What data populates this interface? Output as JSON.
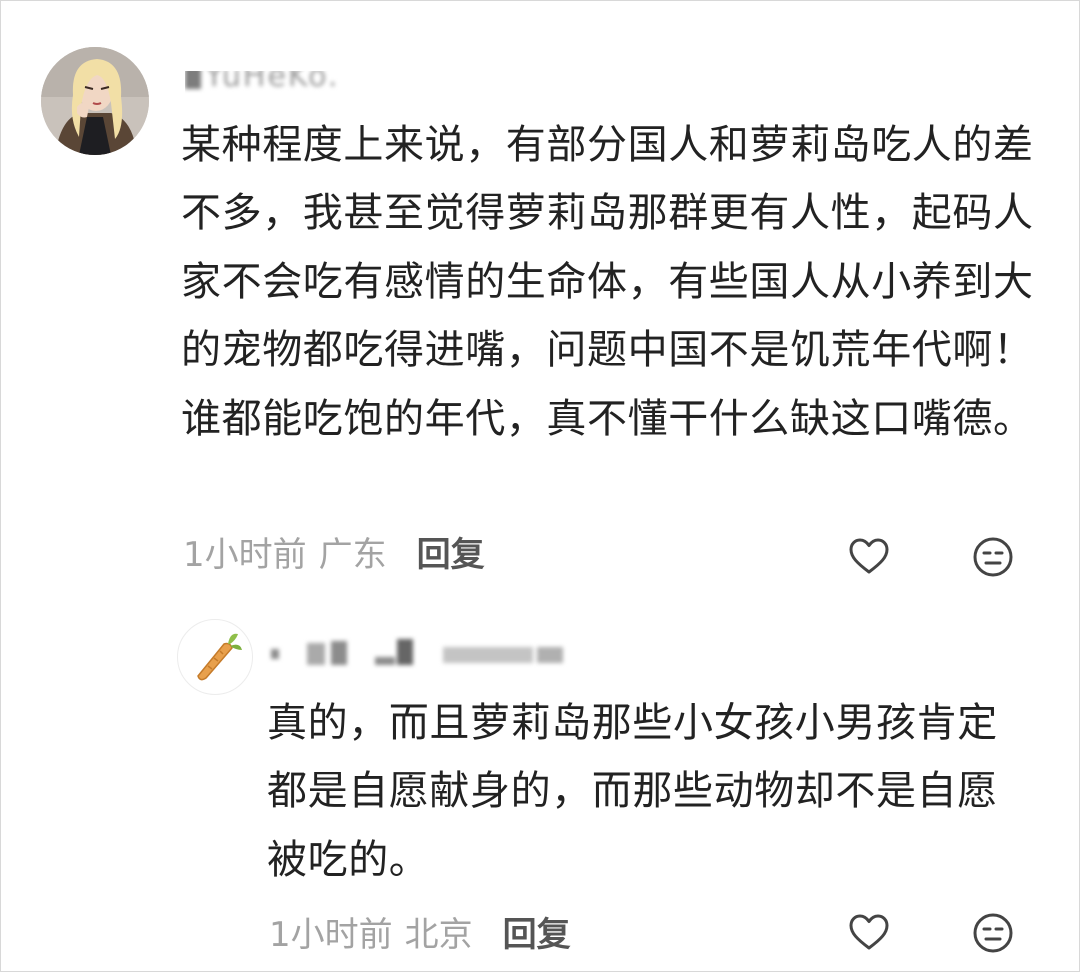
{
  "main_comment": {
    "username": "YuHeKo.",
    "text": "某种程度上来说，有部分国人和萝莉岛吃人的差不多，我甚至觉得萝莉岛那群更有人性，起码人家不会吃有感情的生命体，有些国人从小养到大的宠物都吃得进嘴，问题中国不是饥荒年代啊！谁都能吃饱的年代，真不懂干什么缺这口嘴德。",
    "time": "1小时前",
    "location": "广东",
    "reply_label": "回复",
    "like_icon": "heart-outline-icon",
    "dislike_icon": "unhappy-face-icon"
  },
  "reply_comment": {
    "text": "真的，而且萝莉岛那些小女孩小男孩肯定都是自愿献身的，而那些动物却不是自愿被吃的。",
    "time": "1小时前",
    "location": "北京",
    "reply_label": "回复",
    "avatar_icon": "carrot-icon",
    "like_icon": "heart-outline-icon",
    "dislike_icon": "unhappy-face-icon"
  },
  "colors": {
    "text": "#222222",
    "meta": "#a3a3a3",
    "reply": "#555555",
    "icon": "#444444",
    "carrot": "#e8a04c"
  }
}
